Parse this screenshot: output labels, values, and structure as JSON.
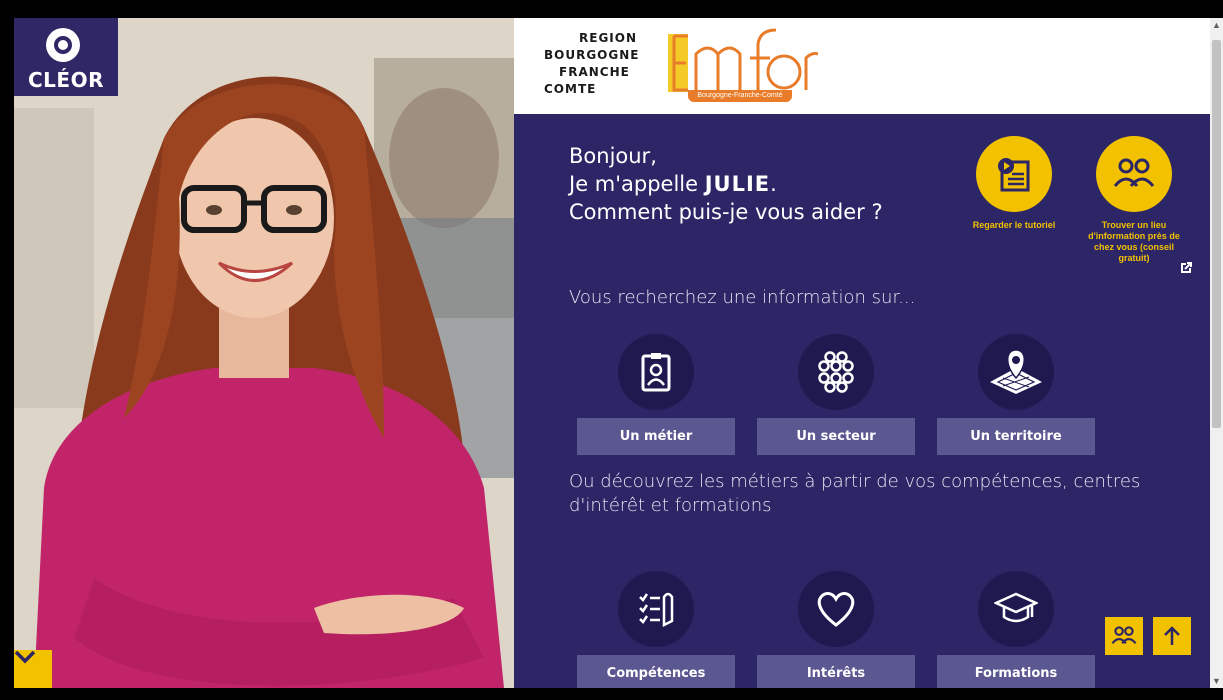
{
  "brand": {
    "name": "CLÉOR",
    "icon": "cleor-logo-icon"
  },
  "region_logo": {
    "lines": [
      "REGION",
      "BOURGOGNE",
      "FRANCHE",
      "COMTE"
    ]
  },
  "emfor_logo": {
    "name": "Emfor",
    "subtitle": "Bourgogne-Franche-Comté"
  },
  "greeting": {
    "line1": "Bonjour,",
    "line2_prefix": "Je m'appelle ",
    "name": "JULIE",
    "line2_suffix": ".",
    "line3": "Comment puis-je vous aider ?"
  },
  "quick_links": {
    "tutorial": {
      "label": "Regarder le tutoriel",
      "icon": "video-tutorial-icon"
    },
    "find_place": {
      "label": "Trouver un lieu d'information près de chez vous (conseil gratuit)",
      "icon": "people-icon",
      "ext_icon": "external-link-icon"
    }
  },
  "section1": {
    "title": "Vous recherchez une information sur...",
    "items": [
      {
        "label": "Un métier",
        "icon": "id-badge-icon"
      },
      {
        "label": "Un secteur",
        "icon": "network-cluster-icon"
      },
      {
        "label": "Un territoire",
        "icon": "map-pin-icon"
      }
    ]
  },
  "section2": {
    "title": "Ou découvrez les métiers à partir de vos compétences, centres d'intérêt et formations",
    "items": [
      {
        "label": "Compétences",
        "icon": "checklist-pen-icon"
      },
      {
        "label": "Intérêts",
        "icon": "heart-icon"
      },
      {
        "label": "Formations",
        "icon": "graduation-cap-icon"
      }
    ]
  },
  "colors": {
    "navy": "#2c2566",
    "yellow": "#f2c200",
    "button": "#5b5791",
    "orange": "#e87c2a"
  }
}
